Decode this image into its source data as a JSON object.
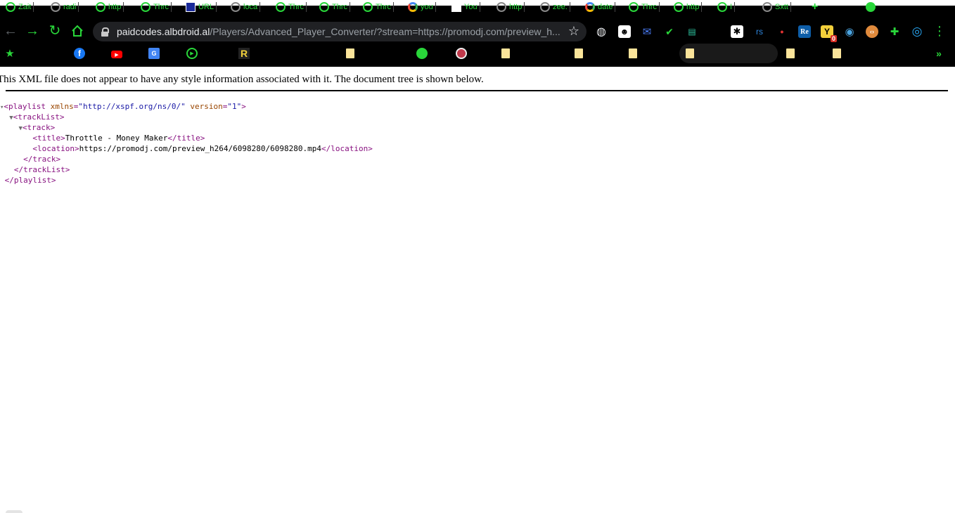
{
  "browser": {
    "tabs": [
      {
        "label": "Zait",
        "icon": "green-play-icon"
      },
      {
        "label": "radi",
        "icon": "globe-icon"
      },
      {
        "label": "http",
        "icon": "green-play-icon"
      },
      {
        "label": "Thrc",
        "icon": "green-play-icon"
      },
      {
        "label": "URL",
        "icon": "tools-icon"
      },
      {
        "label": "loca",
        "icon": "globe-icon"
      },
      {
        "label": "Thrc",
        "icon": "green-play-icon"
      },
      {
        "label": "Thrc",
        "icon": "green-play-icon"
      },
      {
        "label": "Thrc",
        "icon": "green-play-icon"
      },
      {
        "label": "you",
        "icon": "google-icon"
      },
      {
        "label": "You",
        "icon": "blank-page-icon"
      },
      {
        "label": "http",
        "icon": "globe-icon"
      },
      {
        "label": "zee.",
        "icon": "github-icon"
      },
      {
        "label": "date",
        "icon": "google-icon"
      },
      {
        "label": "Thrc",
        "icon": "green-play-icon"
      },
      {
        "label": "http",
        "icon": "green-play-icon"
      },
      {
        "label": "I",
        "icon": "green-play-icon"
      },
      {
        "label": "Sxtt",
        "icon": "github-icon"
      }
    ],
    "new_tab_glyph": "+",
    "url_host": "paidcodes.albdroid.al",
    "url_path": "/Players/Advanced_Player_Converter/?stream=https://promodj.com/preview_h...",
    "extensions": [
      {
        "name": "globe-extension-icon",
        "glyph": "◍"
      },
      {
        "name": "spy-extension-icon",
        "glyph": "☻"
      },
      {
        "name": "mail-extension-icon",
        "glyph": "✉"
      },
      {
        "name": "check-extension-icon",
        "glyph": "✔"
      },
      {
        "name": "dict-extension-icon",
        "glyph": "▤"
      },
      {
        "name": "asterisk-extension-icon",
        "glyph": "✱"
      },
      {
        "name": "rs-extension-icon",
        "glyph": "rs"
      },
      {
        "name": "red-dot-extension-icon",
        "glyph": "•"
      },
      {
        "name": "re-extension-icon",
        "glyph": "Re"
      },
      {
        "name": "y-extension-icon",
        "glyph": "Y",
        "badge": "0"
      },
      {
        "name": "earth-extension-icon",
        "glyph": "◉"
      },
      {
        "name": "code-extension-icon",
        "glyph": "‹›"
      },
      {
        "name": "puzzle-extension-icon",
        "glyph": "✚"
      },
      {
        "name": "target-extension-icon",
        "glyph": "◎"
      }
    ],
    "menu_glyph": "⋮",
    "bookmarks_more_glyph": "»",
    "bookmark_r_glyph": "R"
  },
  "page": {
    "notice": "This XML file does not appear to have any style information associated with it. The document tree is shown below.",
    "xml": {
      "playlist_open": "<playlist",
      "xmlns_attr": "xmlns",
      "xmlns_value": "\"http://xspf.org/ns/0/\"",
      "version_attr": "version",
      "version_value": "\"1\"",
      "playlist_close": "</playlist>",
      "tracklist_open": "<trackList>",
      "tracklist_close": "</trackList>",
      "track_open": "<track>",
      "track_close": "</track>",
      "title_open": "<title>",
      "title_text": "Throttle - Money Maker",
      "title_close": "</title>",
      "location_open": "<location>",
      "location_text": "https://promodj.com/preview_h264/6098280/6098280.mp4",
      "location_close": "</location>"
    }
  }
}
